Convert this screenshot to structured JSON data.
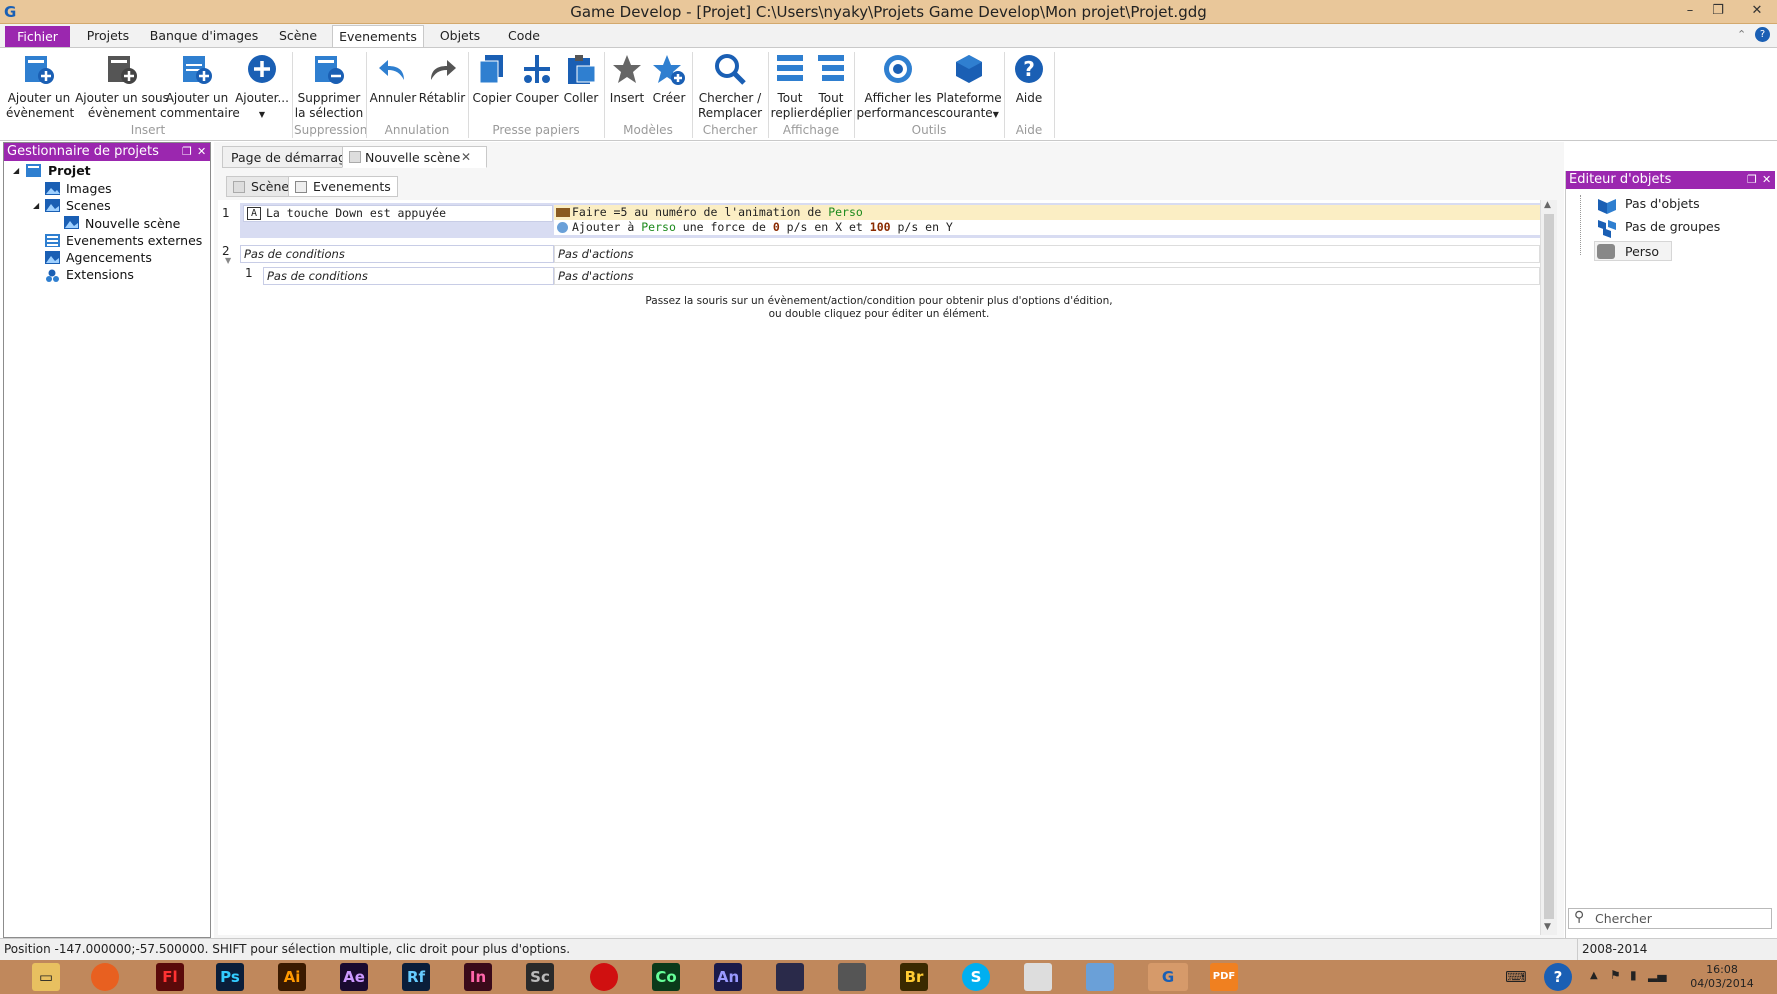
{
  "window": {
    "title": "Game Develop - [Projet] C:\\Users\\nyaky\\Projets Game Develop\\Mon projet\\Projet.gdg",
    "minimize": "–",
    "restore": "❐",
    "close": "✕"
  },
  "ribbon_tabs": [
    "Fichier",
    "Projets",
    "Banque d'images",
    "Scène",
    "Evenements",
    "Objets",
    "Code"
  ],
  "ribbon": {
    "buttons": [
      "Ajouter un\névènement",
      "Ajouter un sous\névènement",
      "Ajouter un\ncommentaire",
      "Ajouter...",
      "Supprimer\nla sélection",
      "Annuler",
      "Rétablir",
      "Copier",
      "Couper",
      "Coller",
      "Insert",
      "Créer",
      "Chercher /\nRemplacer",
      "Tout\nreplier",
      "Tout\ndéplier",
      "Afficher les\nperformances",
      "Plateforme\ncourante",
      "Aide"
    ],
    "groups": [
      "Insert",
      "Suppression",
      "Annulation",
      "Presse papiers",
      "Modèles",
      "Chercher",
      "Affichage",
      "Outils",
      "Aide"
    ]
  },
  "project_panel": {
    "title": "Gestionnaire de projets",
    "tree": [
      "Projet",
      "Images",
      "Scenes",
      "Nouvelle scène",
      "Evenements externes",
      "Agencements",
      "Extensions"
    ]
  },
  "doc_tabs": [
    "Page de démarrage",
    "Nouvelle scène"
  ],
  "sub_tabs": [
    "Scène",
    "Evenements"
  ],
  "events": {
    "ev1_num": "1",
    "ev1_condition": "La touche Down est appuyée",
    "ev1_action1_a": "Faire =5 au numéro de l'animation de ",
    "ev1_action1_obj": "Perso",
    "ev1_action2_a": "Ajouter à ",
    "ev1_action2_obj": "Perso",
    "ev1_action2_b": " une force de ",
    "ev1_action2_v1": "0",
    "ev1_action2_c": " p/s en X et ",
    "ev1_action2_v2": "100",
    "ev1_action2_d": " p/s en Y",
    "ev2_num": "2",
    "no_conditions": "Pas de conditions",
    "no_actions": "Pas d'actions",
    "sub_num": "1",
    "hint_line1": "Passez la souris sur un évènement/action/condition pour obtenir plus d'options d'édition,",
    "hint_line2": "ou double cliquez pour éditer un élément."
  },
  "objects_panel": {
    "title": "Editeur d'objets",
    "items": [
      "Pas d'objets",
      "Pas de groupes",
      "Perso"
    ],
    "search_placeholder": "Chercher"
  },
  "status": {
    "left": "Position -147.000000;-57.500000. SHIFT pour sélection multiple, clic droit pour plus d'options.",
    "right": "2008-2014"
  },
  "taskbar": {
    "apps": [
      "Fl",
      "Ps",
      "Ai",
      "Ae",
      "Rf",
      "In",
      "Sc",
      "Co",
      "An",
      "Br"
    ],
    "time": "16:08",
    "date": "04/03/2014"
  },
  "colors": {
    "accent": "#9b27af",
    "titlebar": "#e9c79a",
    "taskbar": "#c0885c",
    "event_selected": "#d8dcf2",
    "action_highlight": "#fbeec4"
  }
}
